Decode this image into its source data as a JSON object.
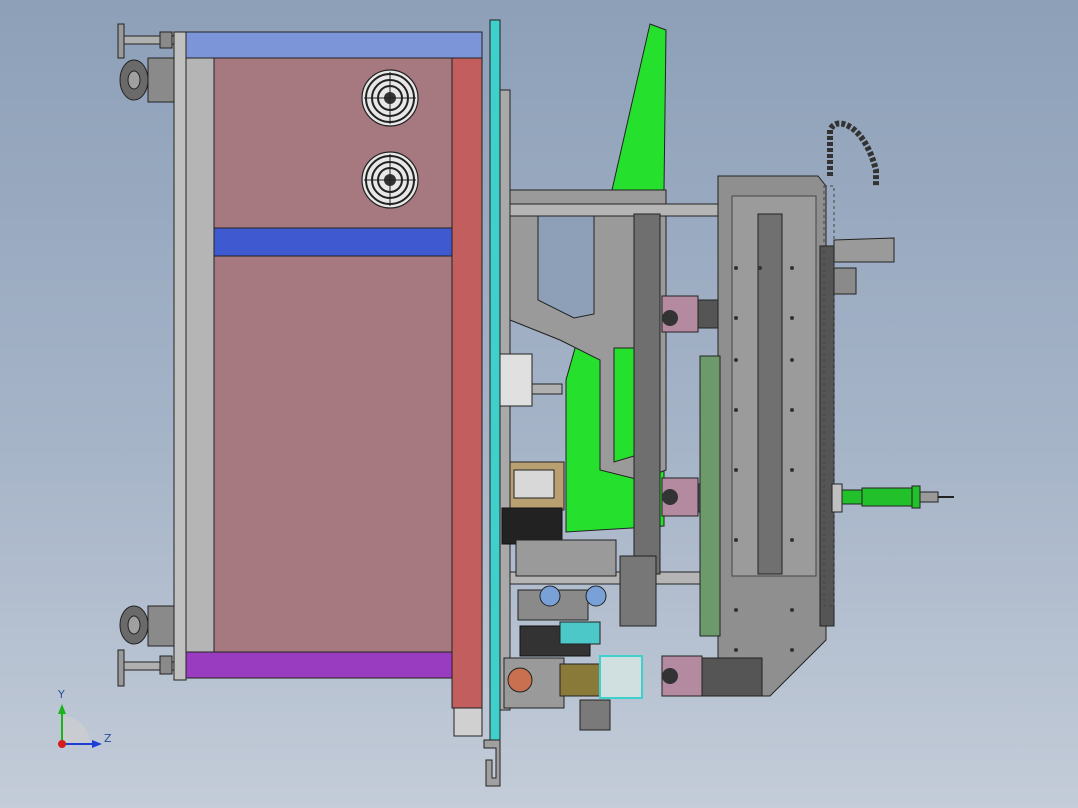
{
  "viewport": {
    "name": "cad-graphics-area"
  },
  "triad": {
    "y_label": "Y",
    "z_label": "Z",
    "colors": {
      "y": "#19b419",
      "z": "#1d3fd6",
      "x": "#d61d1d"
    }
  },
  "colors": {
    "cabinet_panel": "#a67880",
    "cabinet_frame": "#b5b5b5",
    "top_rail": "#7b95d8",
    "mid_rail": "#3f5ad0",
    "bottom_rail": "#9a3cc0",
    "side_panel": "#c25e5e",
    "mount_plate": "#3fd0cc",
    "green_guard": "#25e02d",
    "steel": "#8c8c8c",
    "dark_steel": "#5d5d5d"
  }
}
